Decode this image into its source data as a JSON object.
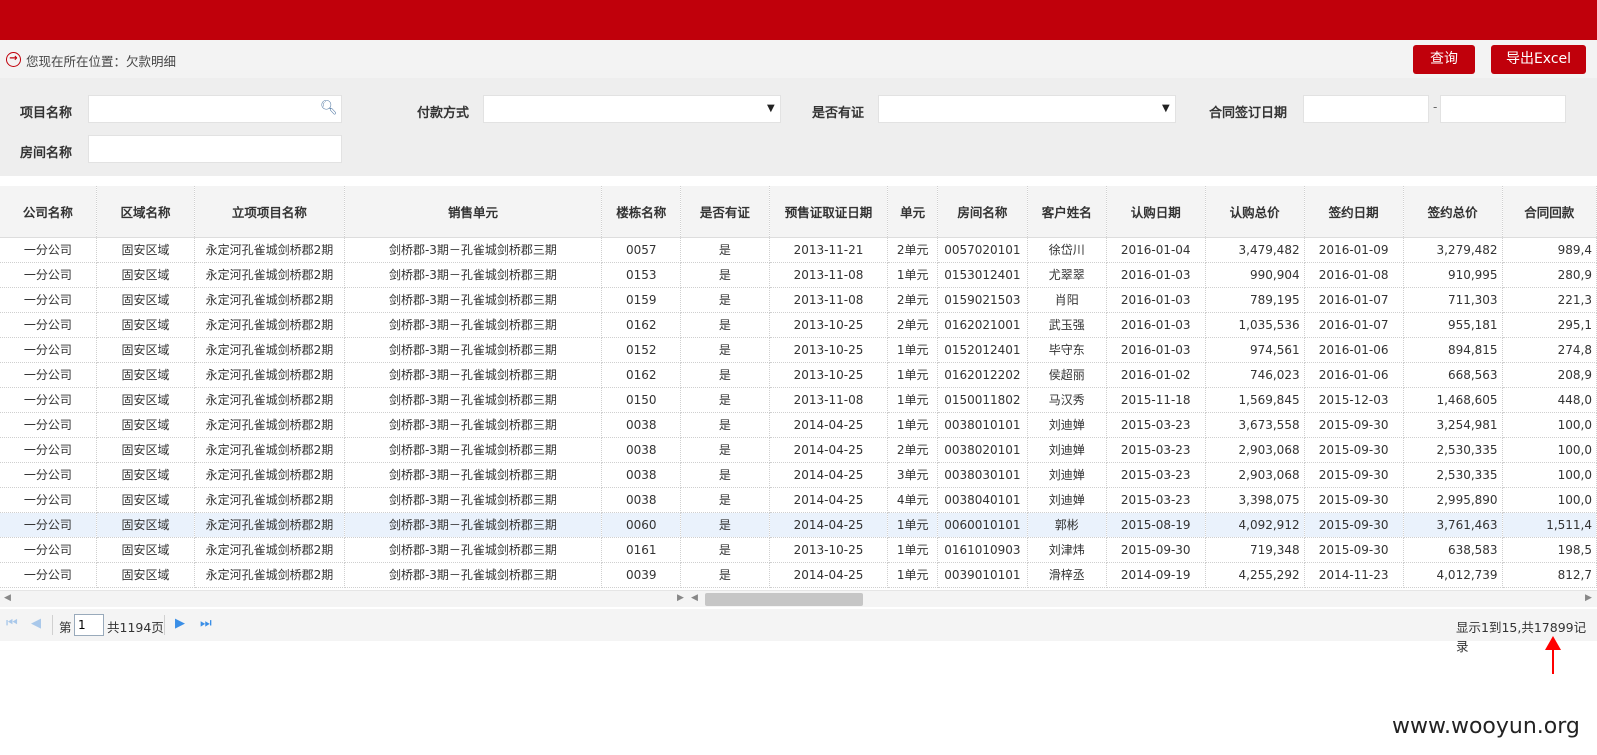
{
  "location": {
    "text": "您现在所在位置：欠款明细"
  },
  "toolbar": {
    "query_label": "查询",
    "export_label": "导出Excel"
  },
  "filters": {
    "project_label": "项目名称",
    "payment_label": "付款方式",
    "cert_label": "是否有证",
    "contract_date_label": "合同签订日期",
    "room_label": "房间名称",
    "date_separator": "-"
  },
  "table": {
    "columns": [
      "公司名称",
      "区域名称",
      "立项项目名称",
      "销售单元",
      "楼栋名称",
      "是否有证",
      "预售证取证日期",
      "单元",
      "房间名称",
      "客户姓名",
      "认购日期",
      "认购总价",
      "签约日期",
      "签约总价",
      "合同回款"
    ],
    "rows": [
      [
        "一分公司",
        "固安区域",
        "永定河孔雀城剑桥郡2期",
        "剑桥郡-3期－孔雀城剑桥郡三期",
        "0057",
        "是",
        "2013-11-21",
        "2单元",
        "0057020101",
        "徐岱川",
        "2016-01-04",
        "3,479,482",
        "2016-01-09",
        "3,279,482",
        "989,4"
      ],
      [
        "一分公司",
        "固安区域",
        "永定河孔雀城剑桥郡2期",
        "剑桥郡-3期－孔雀城剑桥郡三期",
        "0153",
        "是",
        "2013-11-08",
        "1单元",
        "0153012401",
        "尤翠翠",
        "2016-01-03",
        "990,904",
        "2016-01-08",
        "910,995",
        "280,9"
      ],
      [
        "一分公司",
        "固安区域",
        "永定河孔雀城剑桥郡2期",
        "剑桥郡-3期－孔雀城剑桥郡三期",
        "0159",
        "是",
        "2013-11-08",
        "2单元",
        "0159021503",
        "肖阳",
        "2016-01-03",
        "789,195",
        "2016-01-07",
        "711,303",
        "221,3"
      ],
      [
        "一分公司",
        "固安区域",
        "永定河孔雀城剑桥郡2期",
        "剑桥郡-3期－孔雀城剑桥郡三期",
        "0162",
        "是",
        "2013-10-25",
        "2单元",
        "0162021001",
        "武玉强",
        "2016-01-03",
        "1,035,536",
        "2016-01-07",
        "955,181",
        "295,1"
      ],
      [
        "一分公司",
        "固安区域",
        "永定河孔雀城剑桥郡2期",
        "剑桥郡-3期－孔雀城剑桥郡三期",
        "0152",
        "是",
        "2013-10-25",
        "1单元",
        "0152012401",
        "毕守东",
        "2016-01-03",
        "974,561",
        "2016-01-06",
        "894,815",
        "274,8"
      ],
      [
        "一分公司",
        "固安区域",
        "永定河孔雀城剑桥郡2期",
        "剑桥郡-3期－孔雀城剑桥郡三期",
        "0162",
        "是",
        "2013-10-25",
        "1单元",
        "0162012202",
        "侯超丽",
        "2016-01-02",
        "746,023",
        "2016-01-06",
        "668,563",
        "208,9"
      ],
      [
        "一分公司",
        "固安区域",
        "永定河孔雀城剑桥郡2期",
        "剑桥郡-3期－孔雀城剑桥郡三期",
        "0150",
        "是",
        "2013-11-08",
        "1单元",
        "0150011802",
        "马汉秀",
        "2015-11-18",
        "1,569,845",
        "2015-12-03",
        "1,468,605",
        "448,0"
      ],
      [
        "一分公司",
        "固安区域",
        "永定河孔雀城剑桥郡2期",
        "剑桥郡-3期－孔雀城剑桥郡三期",
        "0038",
        "是",
        "2014-04-25",
        "1单元",
        "0038010101",
        "刘迪婵",
        "2015-03-23",
        "3,673,558",
        "2015-09-30",
        "3,254,981",
        "100,0"
      ],
      [
        "一分公司",
        "固安区域",
        "永定河孔雀城剑桥郡2期",
        "剑桥郡-3期－孔雀城剑桥郡三期",
        "0038",
        "是",
        "2014-04-25",
        "2单元",
        "0038020101",
        "刘迪婵",
        "2015-03-23",
        "2,903,068",
        "2015-09-30",
        "2,530,335",
        "100,0"
      ],
      [
        "一分公司",
        "固安区域",
        "永定河孔雀城剑桥郡2期",
        "剑桥郡-3期－孔雀城剑桥郡三期",
        "0038",
        "是",
        "2014-04-25",
        "3单元",
        "0038030101",
        "刘迪婵",
        "2015-03-23",
        "2,903,068",
        "2015-09-30",
        "2,530,335",
        "100,0"
      ],
      [
        "一分公司",
        "固安区域",
        "永定河孔雀城剑桥郡2期",
        "剑桥郡-3期－孔雀城剑桥郡三期",
        "0038",
        "是",
        "2014-04-25",
        "4单元",
        "0038040101",
        "刘迪婵",
        "2015-03-23",
        "3,398,075",
        "2015-09-30",
        "2,995,890",
        "100,0"
      ],
      [
        "一分公司",
        "固安区域",
        "永定河孔雀城剑桥郡2期",
        "剑桥郡-3期－孔雀城剑桥郡三期",
        "0060",
        "是",
        "2014-04-25",
        "1单元",
        "0060010101",
        "郭彬",
        "2015-08-19",
        "4,092,912",
        "2015-09-30",
        "3,761,463",
        "1,511,4"
      ],
      [
        "一分公司",
        "固安区域",
        "永定河孔雀城剑桥郡2期",
        "剑桥郡-3期－孔雀城剑桥郡三期",
        "0161",
        "是",
        "2013-10-25",
        "1单元",
        "0161010903",
        "刘津炜",
        "2015-09-30",
        "719,348",
        "2015-09-30",
        "638,583",
        "198,5"
      ],
      [
        "一分公司",
        "固安区域",
        "永定河孔雀城剑桥郡2期",
        "剑桥郡-3期－孔雀城剑桥郡三期",
        "0039",
        "是",
        "2014-04-25",
        "1单元",
        "0039010101",
        "滑梓丞",
        "2014-09-19",
        "4,255,292",
        "2014-11-23",
        "4,012,739",
        "812,7"
      ]
    ],
    "highlighted_row": 11
  },
  "pager": {
    "page_prefix": "第",
    "page_value": "1",
    "page_total": "共1194页",
    "summary": "显示1到15,共17899记录"
  },
  "watermark": "www.wooyun.org",
  "colors": {
    "brand_red": "#c0000b",
    "pager_blue": "#3a8ee6",
    "annotation_red": "#ff0000"
  }
}
